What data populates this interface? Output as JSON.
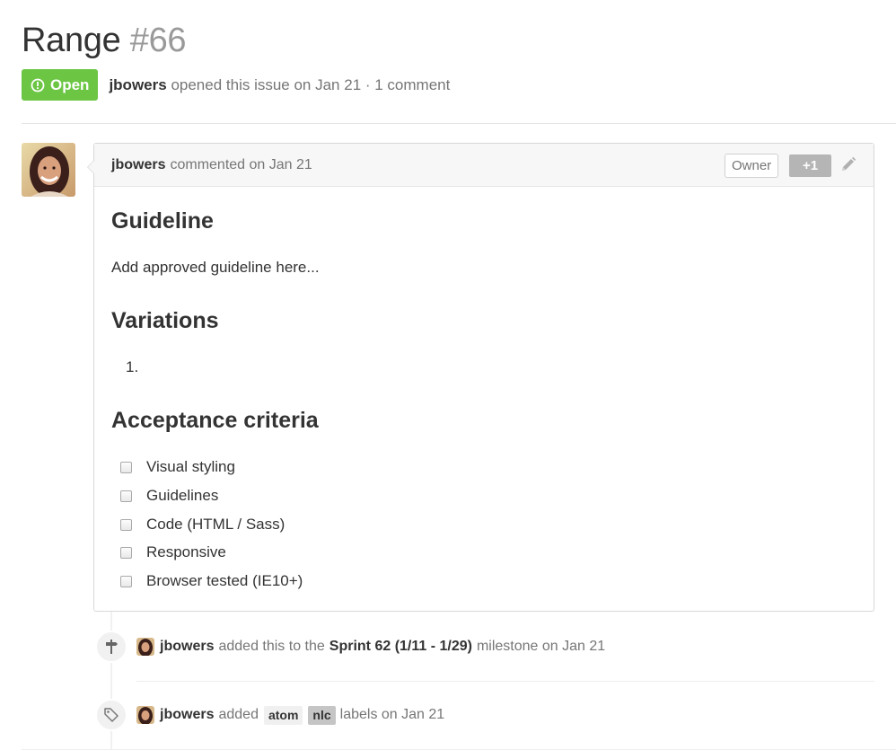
{
  "issue": {
    "title": "Range",
    "number": "#66",
    "state": "Open",
    "author": "jbowers",
    "meta_rest": "opened this issue on Jan 21 · 1 comment"
  },
  "comment": {
    "author": "jbowers",
    "action": "commented on Jan 21",
    "owner_label": "Owner",
    "reaction_label": "+1",
    "body": {
      "h_guideline": "Guideline",
      "guideline_text": "Add approved guideline here...",
      "h_variations": "Variations",
      "variations_first": "1.",
      "h_acceptance": "Acceptance criteria",
      "tasks": [
        "Visual styling",
        "Guidelines",
        "Code (HTML / Sass)",
        "Responsive",
        "Browser tested (IE10+)"
      ]
    }
  },
  "timeline": {
    "milestone": {
      "actor": "jbowers",
      "text_before": "added this to the",
      "milestone_name": "Sprint 62 (1/11 - 1/29)",
      "text_after": "milestone on Jan 21"
    },
    "labels_event": {
      "actor": "jbowers",
      "text_before": "added",
      "labels": [
        {
          "name": "atom",
          "color": "#f0f0f0"
        },
        {
          "name": "nlc",
          "color": "#c5c5c5"
        }
      ],
      "text_after": "labels on Jan 21"
    }
  },
  "colors": {
    "open_state": "#6cc644",
    "reaction_button": "#b5b5b5"
  },
  "icons": {
    "state": "issue-opened-icon",
    "edit": "pencil-icon",
    "milestone": "milestone-icon",
    "label": "tag-icon"
  }
}
